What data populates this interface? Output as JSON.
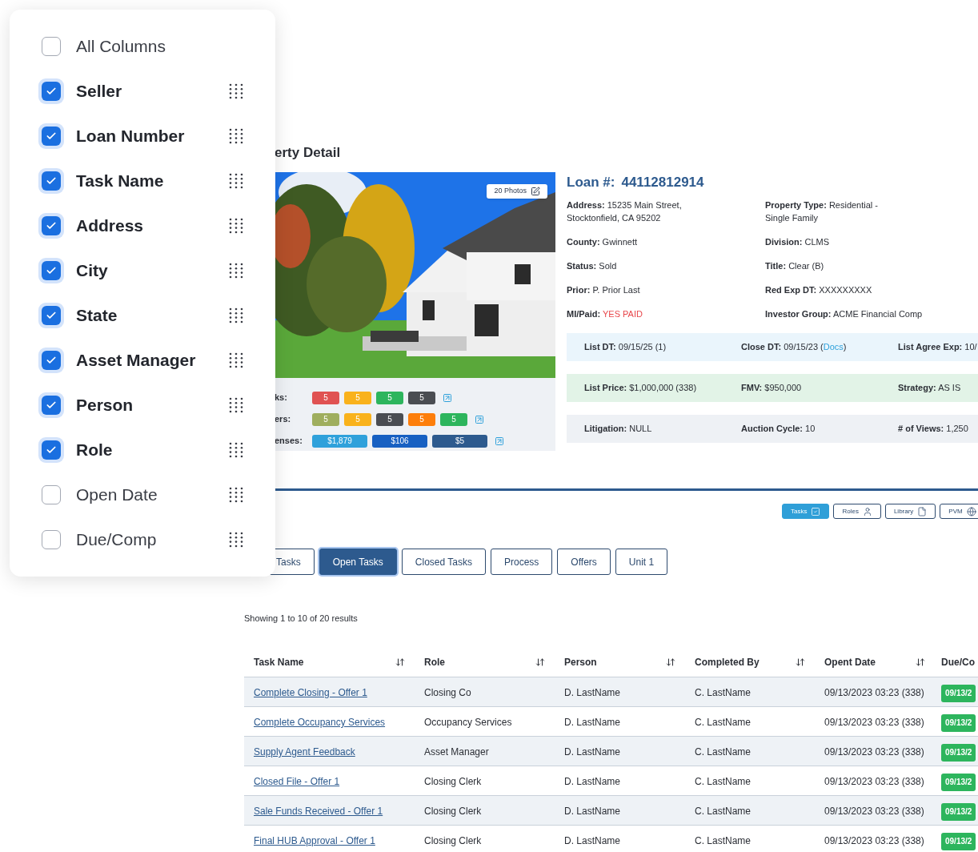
{
  "column_menu": {
    "items": [
      {
        "label": "All Columns",
        "checked": false,
        "draggable": false
      },
      {
        "label": "Seller",
        "checked": true,
        "draggable": true
      },
      {
        "label": "Loan Number",
        "checked": true,
        "draggable": true
      },
      {
        "label": "Task Name",
        "checked": true,
        "draggable": true
      },
      {
        "label": "Address",
        "checked": true,
        "draggable": true
      },
      {
        "label": "City",
        "checked": true,
        "draggable": true
      },
      {
        "label": "State",
        "checked": true,
        "draggable": true
      },
      {
        "label": "Asset Manager",
        "checked": true,
        "draggable": true
      },
      {
        "label": "Person",
        "checked": true,
        "draggable": true
      },
      {
        "label": "Role",
        "checked": true,
        "draggable": true
      },
      {
        "label": "Open Date",
        "checked": false,
        "draggable": true
      },
      {
        "label": "Due/Comp",
        "checked": false,
        "draggable": true
      }
    ]
  },
  "heading": "erty Detail",
  "photos_button": "20 Photos",
  "stats": [
    {
      "label": "ks:",
      "kind": "count",
      "badges": [
        {
          "text": "5",
          "color": "#e05252"
        },
        {
          "text": "5",
          "color": "#f9b21c"
        },
        {
          "text": "5",
          "color": "#2db55d"
        },
        {
          "text": "5",
          "color": "#4a4d52"
        }
      ]
    },
    {
      "label": "ers:",
      "kind": "count",
      "badges": [
        {
          "text": "5",
          "color": "#9fae5e"
        },
        {
          "text": "5",
          "color": "#f9b21c"
        },
        {
          "text": "5",
          "color": "#4a4d52"
        },
        {
          "text": "5",
          "color": "#fd7e0b"
        },
        {
          "text": "5",
          "color": "#2db55d"
        }
      ]
    },
    {
      "label": "enses:",
      "kind": "amount",
      "badges": [
        {
          "text": "$1,879",
          "color": "#2fa1db"
        },
        {
          "text": "$106",
          "color": "#1760c2"
        },
        {
          "text": "$5",
          "color": "#2d5a8e"
        }
      ]
    }
  ],
  "loan": {
    "label": "Loan #:",
    "number": "44112812914"
  },
  "details": [
    {
      "label": "Address:",
      "value": "15235 Main Street, Stocktonfield, CA 95202",
      "highlight": false
    },
    {
      "label": "Property Type:",
      "value": "Residential - Single Family",
      "highlight": false
    },
    {
      "label": "County:",
      "value": "Gwinnett",
      "highlight": false
    },
    {
      "label": "Division:",
      "value": "CLMS",
      "highlight": false
    },
    {
      "label": "Status:",
      "value": "Sold",
      "highlight": false
    },
    {
      "label": "Title:",
      "value": "Clear  (B)",
      "highlight": false
    },
    {
      "label": "Prior:",
      "value": "P. Prior Last",
      "highlight": false
    },
    {
      "label": "Red Exp DT:",
      "value": "XXXXXXXXX",
      "highlight": false
    },
    {
      "label": "MI/Paid:",
      "value": "YES PAID",
      "highlight": true
    },
    {
      "label": "Investor Group:",
      "value": "ACME Financial Comp",
      "highlight": false
    }
  ],
  "bands": [
    {
      "kind": "info",
      "fields": [
        {
          "label": "List DT:",
          "value": "09/15/25 (1)"
        },
        {
          "label": "Close DT:",
          "value": "09/15/23  (",
          "link": "Docs",
          "suffix": ")"
        },
        {
          "label": "List Agree Exp:",
          "value": "10/"
        }
      ]
    },
    {
      "kind": "price",
      "fields": [
        {
          "label": "List Price:",
          "value": "$1,000,000 (338)"
        },
        {
          "label": "FMV:",
          "value": "$950,000"
        },
        {
          "label": "Strategy:",
          "value": "AS IS"
        }
      ]
    },
    {
      "kind": "neutral",
      "fields": [
        {
          "label": "Litigation:",
          "value": "NULL"
        },
        {
          "label": "Auction Cycle:",
          "value": "10"
        },
        {
          "label": "# of Views:",
          "value": "1,250"
        }
      ]
    }
  ],
  "tools": [
    {
      "label": "Tasks",
      "kind": "tasks",
      "selected": true
    },
    {
      "label": "Roles",
      "kind": "roles",
      "selected": false
    },
    {
      "label": "Library",
      "kind": "library",
      "selected": false
    },
    {
      "label": "PVM",
      "kind": "pvm",
      "selected": false
    }
  ],
  "tabs": [
    {
      "label": "Tasks",
      "selected": false
    },
    {
      "label": "Open Tasks",
      "selected": true
    },
    {
      "label": "Closed Tasks",
      "selected": false
    },
    {
      "label": "Process",
      "selected": false
    },
    {
      "label": "Offers",
      "selected": false
    },
    {
      "label": "Unit 1",
      "selected": false
    }
  ],
  "results_text": "Showing 1 to 10 of 20 results",
  "table": {
    "columns": [
      {
        "label": "Task Name",
        "sortable": true
      },
      {
        "label": "Role",
        "sortable": true
      },
      {
        "label": "Person",
        "sortable": true
      },
      {
        "label": "Completed By",
        "sortable": true
      },
      {
        "label": "Opent Date",
        "sortable": true
      },
      {
        "label": "Due/Co"
      }
    ],
    "rows": [
      {
        "task": "Complete Closing - Offer 1",
        "role": "Closing Co",
        "person": "D. LastName",
        "completed_by": "C. LastName",
        "open_date": "09/13/2023 03:23 (338)",
        "due": "09/13/2"
      },
      {
        "task": "Complete Occupancy Services",
        "role": "Occupancy Services",
        "person": "D. LastName",
        "completed_by": "C. LastName",
        "open_date": "09/13/2023 03:23 (338)",
        "due": "09/13/2"
      },
      {
        "task": "Supply Agent Feedback",
        "role": "Asset Manager",
        "person": "D. LastName",
        "completed_by": "C. LastName",
        "open_date": "09/13/2023 03:23 (338)",
        "due": "09/13/2"
      },
      {
        "task": "Closed File - Offer 1",
        "role": "Closing Clerk",
        "person": "D. LastName",
        "completed_by": "C. LastName",
        "open_date": "09/13/2023 03:23 (338)",
        "due": "09/13/2"
      },
      {
        "task": "Sale Funds Received - Offer 1",
        "role": "Closing Clerk",
        "person": "D. LastName",
        "completed_by": "C. LastName",
        "open_date": "09/13/2023 03:23 (338)",
        "due": "09/13/2"
      },
      {
        "task": "Final HUB Approval - Offer 1",
        "role": "Closing Clerk",
        "person": "D. LastName",
        "completed_by": "C. LastName",
        "open_date": "09/13/2023 03:23 (338)",
        "due": "09/13/2"
      }
    ]
  }
}
